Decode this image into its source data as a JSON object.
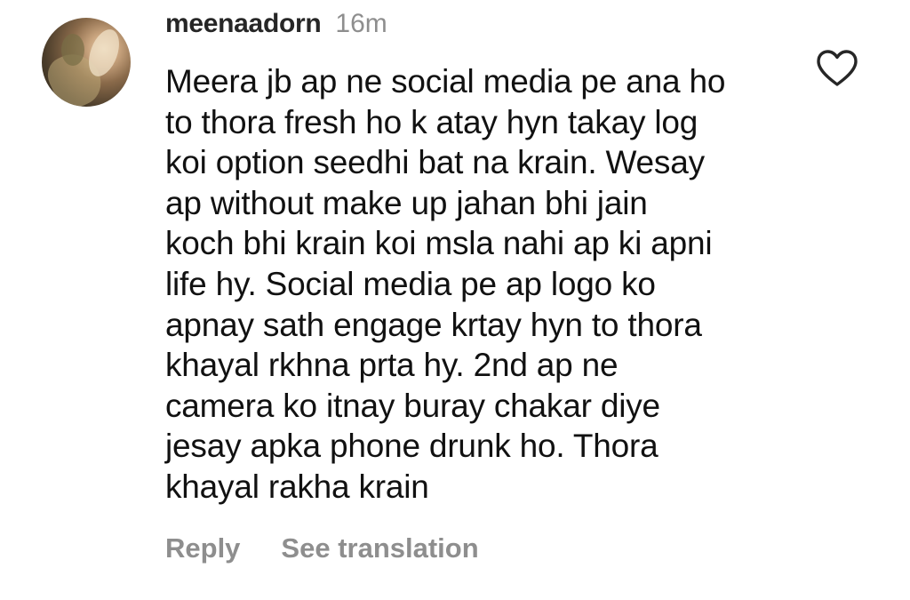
{
  "comment": {
    "username": "meenaadorn",
    "timestamp": "16m",
    "body_lines": [
      "Meera jb ap ne social media pe ana ho",
      "to thora fresh ho k atay hyn takay log",
      "koi option seedhi bat na krain. Wesay",
      "ap without make up jahan bhi jain",
      "koch bhi krain koi msla nahi ap ki apni",
      "life hy. Social media pe ap logo ko",
      "apnay sath engage krtay hyn to thora",
      "khayal rkhna prta hy. 2nd ap ne",
      "camera ko itnay buray chakar diye",
      "jesay apka phone drunk ho. Thora",
      "khayal rakha krain"
    ],
    "like_icon": "heart-outline-icon",
    "actions": {
      "reply_label": "Reply",
      "translate_label": "See translation"
    }
  },
  "colors": {
    "text": "#111111",
    "username": "#262626",
    "muted": "#8e8e8e",
    "background": "#ffffff"
  }
}
